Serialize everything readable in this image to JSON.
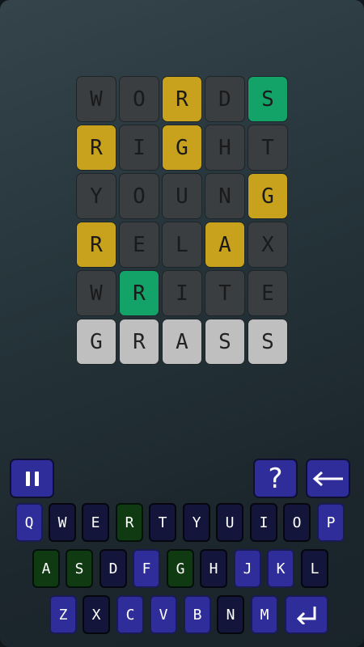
{
  "board": {
    "rows": [
      {
        "letters": [
          "W",
          "O",
          "R",
          "D",
          "S"
        ],
        "states": [
          "absent",
          "absent",
          "present",
          "absent",
          "correct"
        ]
      },
      {
        "letters": [
          "R",
          "I",
          "G",
          "H",
          "T"
        ],
        "states": [
          "present",
          "absent",
          "present",
          "absent",
          "absent"
        ]
      },
      {
        "letters": [
          "Y",
          "O",
          "U",
          "N",
          "G"
        ],
        "states": [
          "absent",
          "absent",
          "absent",
          "absent",
          "present"
        ]
      },
      {
        "letters": [
          "R",
          "E",
          "L",
          "A",
          "X"
        ],
        "states": [
          "present",
          "absent",
          "absent",
          "present",
          "absent"
        ]
      },
      {
        "letters": [
          "W",
          "R",
          "I",
          "T",
          "E"
        ],
        "states": [
          "absent",
          "correct",
          "absent",
          "absent",
          "absent"
        ]
      },
      {
        "letters": [
          "G",
          "R",
          "A",
          "S",
          "S"
        ],
        "states": [
          "input",
          "input",
          "input",
          "input",
          "input"
        ]
      }
    ]
  },
  "controls": {
    "pause_icon": "pause-icon",
    "help_label": "?",
    "backspace_icon": "left-arrow-icon",
    "enter_icon": "enter-return-icon"
  },
  "keyboard": {
    "row1": [
      {
        "label": "Q",
        "state": "unused"
      },
      {
        "label": "W",
        "state": "absent"
      },
      {
        "label": "E",
        "state": "absent"
      },
      {
        "label": "R",
        "state": "correct"
      },
      {
        "label": "T",
        "state": "absent"
      },
      {
        "label": "Y",
        "state": "absent"
      },
      {
        "label": "U",
        "state": "absent"
      },
      {
        "label": "I",
        "state": "absent"
      },
      {
        "label": "O",
        "state": "absent"
      },
      {
        "label": "P",
        "state": "unused"
      }
    ],
    "row2": [
      {
        "label": "A",
        "state": "correct"
      },
      {
        "label": "S",
        "state": "correct"
      },
      {
        "label": "D",
        "state": "absent"
      },
      {
        "label": "F",
        "state": "unused"
      },
      {
        "label": "G",
        "state": "correct"
      },
      {
        "label": "H",
        "state": "absent"
      },
      {
        "label": "J",
        "state": "unused"
      },
      {
        "label": "K",
        "state": "unused"
      },
      {
        "label": "L",
        "state": "absent"
      }
    ],
    "row3": [
      {
        "label": "Z",
        "state": "unused"
      },
      {
        "label": "X",
        "state": "absent"
      },
      {
        "label": "C",
        "state": "unused"
      },
      {
        "label": "V",
        "state": "unused"
      },
      {
        "label": "B",
        "state": "unused"
      },
      {
        "label": "N",
        "state": "absent"
      },
      {
        "label": "M",
        "state": "unused"
      }
    ]
  },
  "colors": {
    "absent_tile": "#3a3e41",
    "present_tile": "#c8a21c",
    "correct_tile": "#13a268",
    "input_tile": "#bfbfbf",
    "key_unused": "#2e2d9a",
    "key_absent": "#13163a",
    "key_correct": "#0f3a12"
  }
}
